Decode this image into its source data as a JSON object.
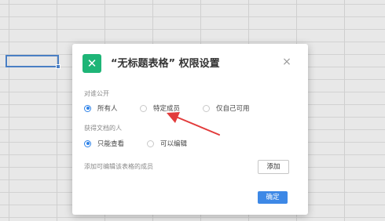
{
  "dialog": {
    "title": "“无标题表格” 权限设置",
    "app_icon_glyph": "✕",
    "close_glyph": "×"
  },
  "visibility": {
    "label": "对谁公开",
    "options": [
      "所有人",
      "特定成员",
      "仅自己可用"
    ],
    "selected": "所有人"
  },
  "access": {
    "label": "获得文档的人",
    "options": [
      "只能查看",
      "可以编辑"
    ],
    "selected": "只能查看"
  },
  "members": {
    "hint": "添加可编辑该表格的成员",
    "add_label": "添加"
  },
  "footer": {
    "ok_label": "确定"
  },
  "colors": {
    "brand": "#1eb577",
    "accent": "#2d82e8",
    "annotation_arrow": "#e23b3b"
  }
}
